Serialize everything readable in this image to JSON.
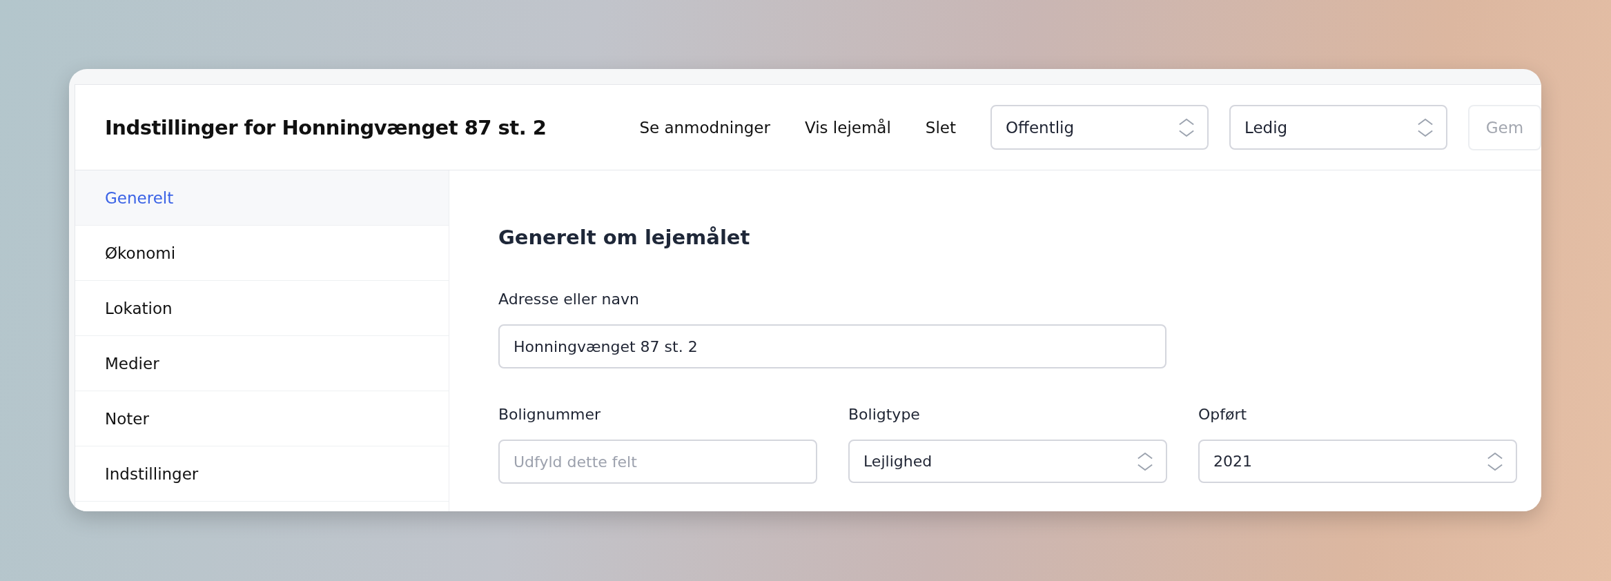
{
  "header": {
    "title": "Indstillinger for Honningvænget 87 st. 2",
    "links": [
      {
        "label": "Se anmodninger"
      },
      {
        "label": "Vis lejemål"
      },
      {
        "label": "Slet"
      }
    ],
    "selects": [
      {
        "value": "Offentlig"
      },
      {
        "value": "Ledig"
      }
    ],
    "save_button": {
      "label": "Gem",
      "disabled": true
    }
  },
  "sidebar": {
    "items": [
      {
        "label": "Generelt",
        "selected": true
      },
      {
        "label": "Økonomi",
        "selected": false
      },
      {
        "label": "Lokation",
        "selected": false
      },
      {
        "label": "Medier",
        "selected": false
      },
      {
        "label": "Noter",
        "selected": false
      },
      {
        "label": "Indstillinger",
        "selected": false
      }
    ]
  },
  "section": {
    "heading": "Generelt om lejemålet",
    "rows": [
      [
        {
          "kind": "text",
          "label": "Adresse eller navn",
          "value": "Honningvænget 87 st. 2"
        }
      ],
      [
        {
          "kind": "text",
          "label": "Bolignummer",
          "placeholder": "Udfyld dette felt"
        },
        {
          "kind": "select",
          "label": "Boligtype",
          "value": "Lejlighed"
        },
        {
          "kind": "select",
          "label": "Opført",
          "value": "2021"
        }
      ]
    ]
  }
}
